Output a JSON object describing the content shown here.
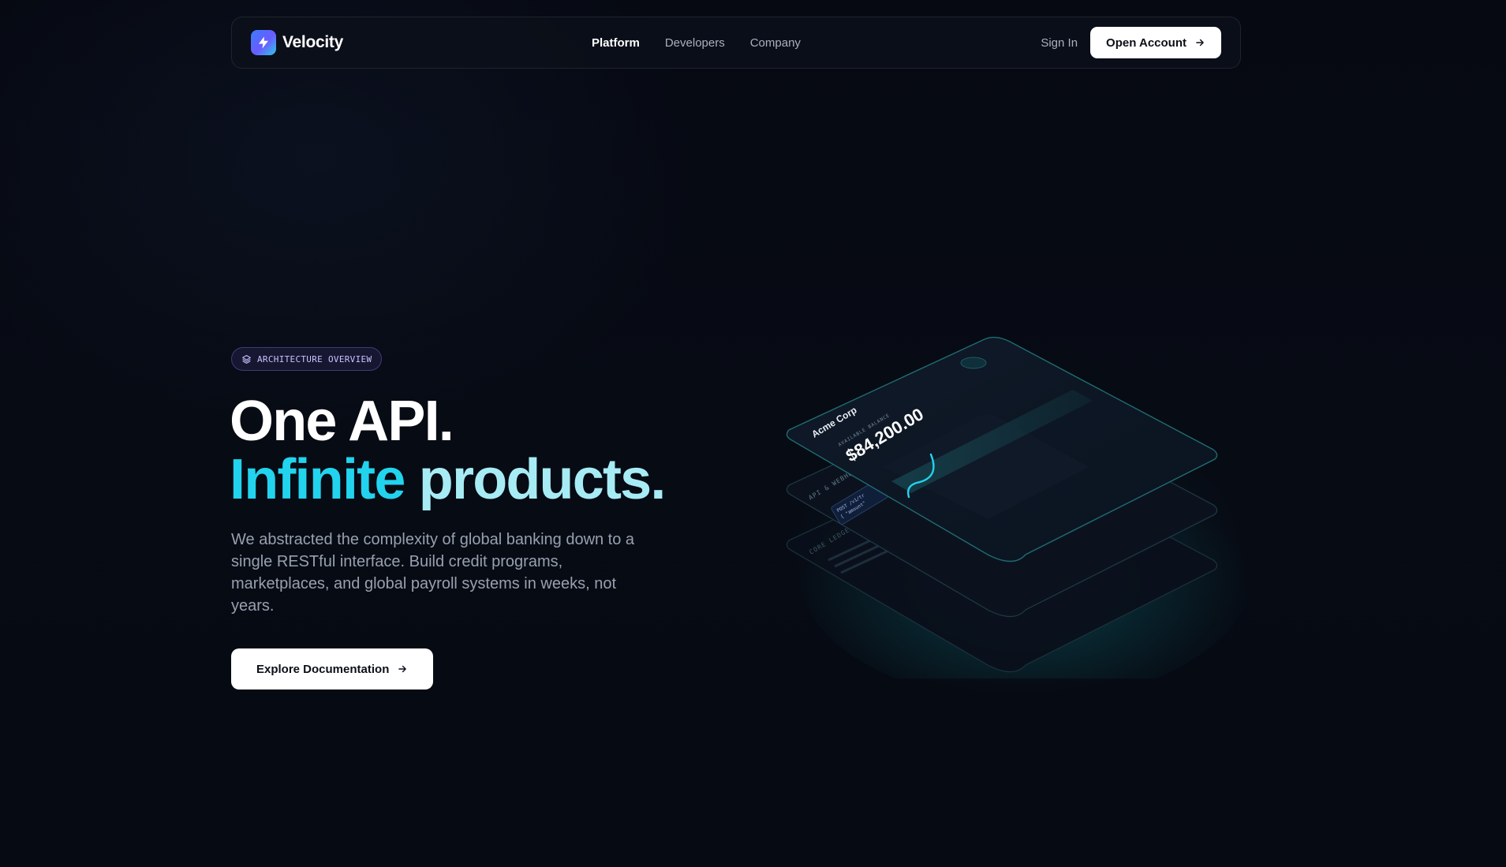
{
  "brand": {
    "name": "Velocity"
  },
  "nav": {
    "links": [
      {
        "label": "Platform",
        "active": true
      },
      {
        "label": "Developers",
        "active": false
      },
      {
        "label": "Company",
        "active": false
      }
    ],
    "sign_in": "Sign In",
    "open_account": "Open Account"
  },
  "hero": {
    "badge": "ARCHITECTURE OVERVIEW",
    "title_line1": "One API.",
    "title_line2_word1": "Infinite",
    "title_line2_word2": "products.",
    "description": "We abstracted the complexity of global banking down to a single RESTful interface. Build credit programs, marketplaces, and global payroll systems in weeks, not years.",
    "cta": "Explore Documentation"
  },
  "illustration": {
    "card_name": "Acme Corp",
    "balance_label": "AVAILABLE BALANCE",
    "balance_value": "$84,200.00",
    "api_label": "API & WEBHOOKS",
    "code_line1": "POST /v1/tr",
    "code_line2": "{ \"amount\"",
    "ledger_label": "CORE LEDGER"
  },
  "colors": {
    "background": "#05080f",
    "accent_cyan": "#22d3ee",
    "accent_cyan_light": "#a7ecf5",
    "badge_text": "#c8c4ff",
    "logo_gradient_start": "#3a7bff",
    "logo_gradient_end": "#2dc9e6"
  },
  "icons": {
    "logo": "lightning-bolt-icon",
    "badge": "layers-icon",
    "button_arrow": "arrow-right-icon"
  }
}
